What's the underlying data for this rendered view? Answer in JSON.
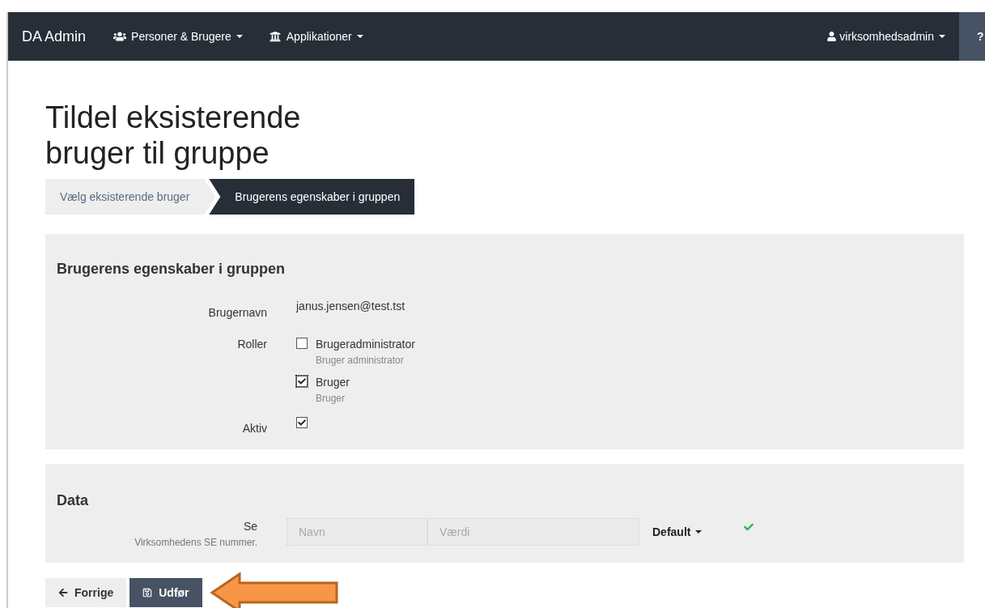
{
  "navbar": {
    "brand": "DA Admin",
    "menus": [
      {
        "kind": "people",
        "label": "Personer & Brugere"
      },
      {
        "kind": "building",
        "label": "Applikationer"
      }
    ],
    "user": {
      "label": "virksomhedsadmin"
    },
    "help": "?"
  },
  "title": "Tildel eksisterende bruger til gruppe",
  "steps": [
    {
      "label": "Vælg eksisterende bruger",
      "selected": false
    },
    {
      "label": "Brugerens egenskaber i gruppen",
      "selected": true
    }
  ],
  "properties": {
    "heading": "Brugerens egenskaber i gruppen",
    "username_label": "Brugernavn",
    "username": "janus.jensen@test.tst",
    "roles_label": "Roller",
    "roles": [
      {
        "name": "Brugeradministrator",
        "description": "Bruger administrator",
        "checked": false,
        "focused": false
      },
      {
        "name": "Bruger",
        "description": "Bruger",
        "checked": true,
        "focused": true
      }
    ],
    "active_label": "Aktiv",
    "active": true
  },
  "data": {
    "heading": "Data",
    "field_label": "Se",
    "field_hint": "Virksomhedens SE nummer.",
    "name_placeholder": "Navn",
    "value_placeholder": "Værdi",
    "dropdown": "Default",
    "valid": true
  },
  "buttons": [
    {
      "kind": "back",
      "label": "Forrige"
    },
    {
      "kind": "save",
      "label": "Udfør"
    }
  ]
}
